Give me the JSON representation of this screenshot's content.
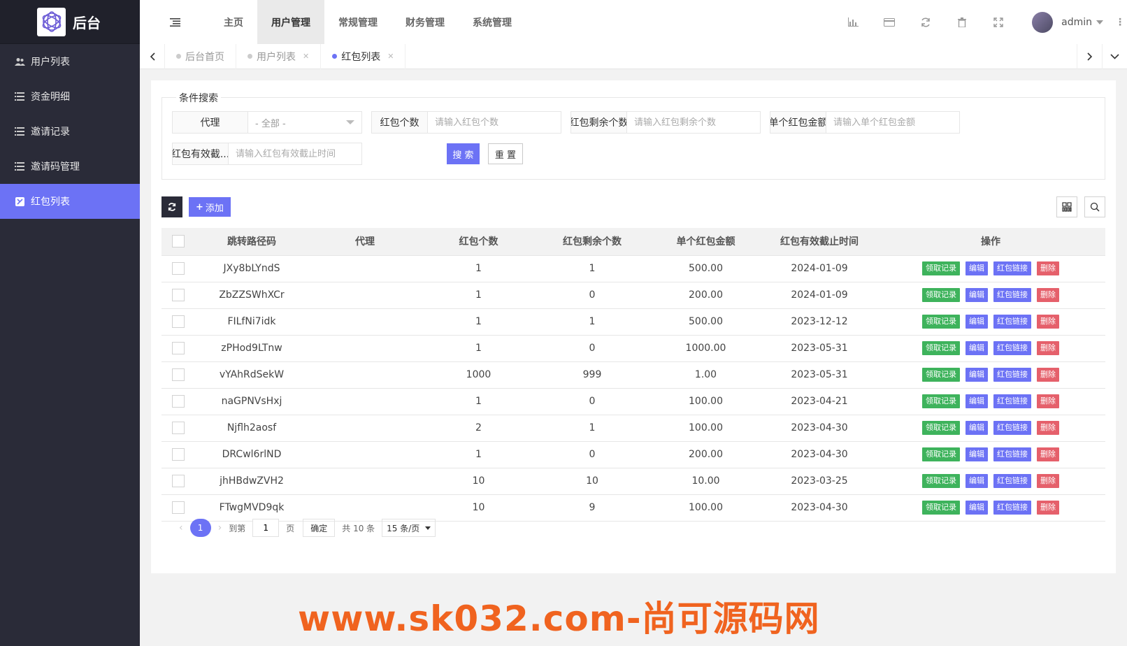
{
  "app": {
    "title": "后台"
  },
  "sidebar": {
    "items": [
      {
        "label": "用户列表",
        "icon": "users-icon"
      },
      {
        "label": "资金明细",
        "icon": "list-icon"
      },
      {
        "label": "邀请记录",
        "icon": "list-icon"
      },
      {
        "label": "邀请码管理",
        "icon": "list-icon"
      },
      {
        "label": "红包列表",
        "icon": "redpacket-icon",
        "active": true
      }
    ]
  },
  "header": {
    "nav": [
      "主页",
      "用户管理",
      "常规管理",
      "财务管理",
      "系统管理"
    ],
    "active_nav": "用户管理",
    "user": "admin"
  },
  "tabs": [
    {
      "label": "后台首页",
      "closable": false
    },
    {
      "label": "用户列表",
      "closable": true
    },
    {
      "label": "红包列表",
      "closable": true,
      "active": true
    }
  ],
  "search": {
    "legend": "条件搜索",
    "agent_label": "代理",
    "agent_value": "- 全部 -",
    "count_label": "红包个数",
    "count_placeholder": "请输入红包个数",
    "remain_label": "红包剩余个数",
    "remain_placeholder": "请输入红包剩余个数",
    "amount_label": "单个红包金额",
    "amount_placeholder": "请输入单个红包金额",
    "expire_label": "红包有效截...",
    "expire_placeholder": "请输入红包有效截止时间",
    "search_btn": "搜 索",
    "reset_btn": "重 置"
  },
  "toolbar": {
    "add_label": "添加"
  },
  "table": {
    "columns": [
      "跳转路径码",
      "代理",
      "红包个数",
      "红包剩余个数",
      "单个红包金额",
      "红包有效截止时间",
      "操作"
    ],
    "actions": [
      "领取记录",
      "编辑",
      "红包链接",
      "删除"
    ],
    "rows": [
      {
        "code": "JXy8bLYndS",
        "agent": "",
        "count": "1",
        "remain": "1",
        "amount": "500.00",
        "expire": "2024-01-09"
      },
      {
        "code": "ZbZZSWhXCr",
        "agent": "",
        "count": "1",
        "remain": "0",
        "amount": "200.00",
        "expire": "2024-01-09"
      },
      {
        "code": "FILfNi7idk",
        "agent": "",
        "count": "1",
        "remain": "1",
        "amount": "500.00",
        "expire": "2023-12-12"
      },
      {
        "code": "zPHod9LTnw",
        "agent": "",
        "count": "1",
        "remain": "0",
        "amount": "1000.00",
        "expire": "2023-05-31"
      },
      {
        "code": "vYAhRdSekW",
        "agent": "",
        "count": "1000",
        "remain": "999",
        "amount": "1.00",
        "expire": "2023-05-31"
      },
      {
        "code": "naGPNVsHxj",
        "agent": "",
        "count": "1",
        "remain": "0",
        "amount": "100.00",
        "expire": "2023-04-21"
      },
      {
        "code": "Njflh2aosf",
        "agent": "",
        "count": "2",
        "remain": "1",
        "amount": "100.00",
        "expire": "2023-04-30"
      },
      {
        "code": "DRCwl6rlND",
        "agent": "",
        "count": "1",
        "remain": "0",
        "amount": "200.00",
        "expire": "2023-04-30"
      },
      {
        "code": "jhHBdwZVH2",
        "agent": "",
        "count": "10",
        "remain": "10",
        "amount": "10.00",
        "expire": "2023-03-25"
      },
      {
        "code": "FTwgMVD9qk",
        "agent": "",
        "count": "10",
        "remain": "9",
        "amount": "100.00",
        "expire": "2023-04-30"
      }
    ]
  },
  "pager": {
    "current": "1",
    "goto_label": "到第",
    "page_input": "1",
    "page_suffix": "页",
    "confirm": "确定",
    "total": "共 10 条",
    "page_size": "15 条/页"
  },
  "watermark": "www.sk032.com-尚可源码网",
  "colors": {
    "accent": "#6c72f5",
    "sidebar": "#2a2b38",
    "green": "#3eb35c",
    "red": "#e5606b",
    "watermark": "#f0631f"
  }
}
